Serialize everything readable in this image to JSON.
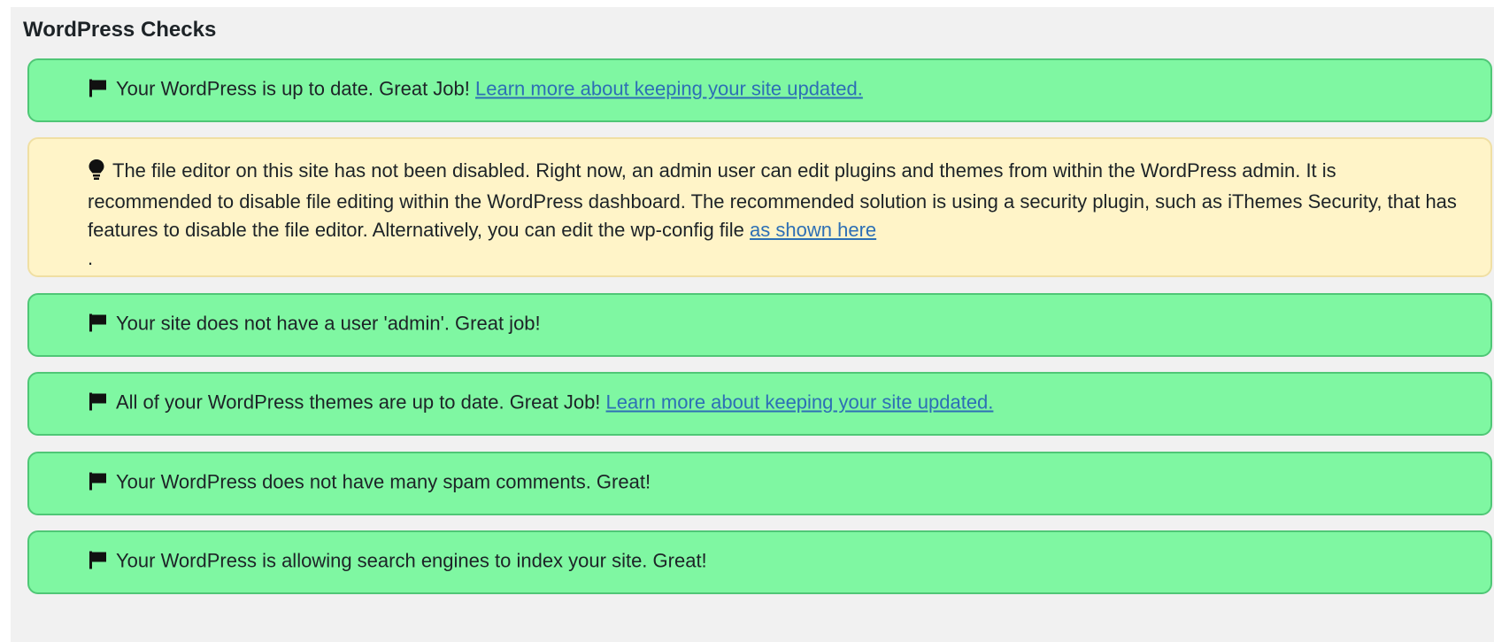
{
  "section": {
    "title": "WordPress Checks"
  },
  "checks": [
    {
      "status": "pass",
      "icon": "flag-icon",
      "text": "Your WordPress is up to date. Great Job!",
      "link": "Learn more about keeping your site updated."
    },
    {
      "status": "warning",
      "icon": "lightbulb-icon",
      "text": "The file editor on this site has not been disabled. Right now, an admin user can edit plugins and themes from within the WordPress admin. It is recommended to disable file editing within the WordPress dashboard. The recommended solution is using a security plugin, such as iThemes Security, that has features to disable the file editor. Alternatively, you can edit the wp-config file",
      "link": "as shown here",
      "suffix": "."
    },
    {
      "status": "pass",
      "icon": "flag-icon",
      "text": "Your site does not have a user 'admin'. Great job!"
    },
    {
      "status": "pass",
      "icon": "flag-icon",
      "text": "All of your WordPress themes are up to date. Great Job!",
      "link": "Learn more about keeping your site updated."
    },
    {
      "status": "pass",
      "icon": "flag-icon",
      "text": "Your WordPress does not have many spam comments. Great!"
    },
    {
      "status": "pass",
      "icon": "flag-icon",
      "text": "Your WordPress is allowing search engines to index your site. Great!"
    }
  ],
  "colors": {
    "pass_background": "#7ff7a2",
    "pass_border": "#4fc776",
    "warning_background": "#fff4c8",
    "warning_border": "#f0dfa3",
    "link": "#2d6fb5"
  }
}
